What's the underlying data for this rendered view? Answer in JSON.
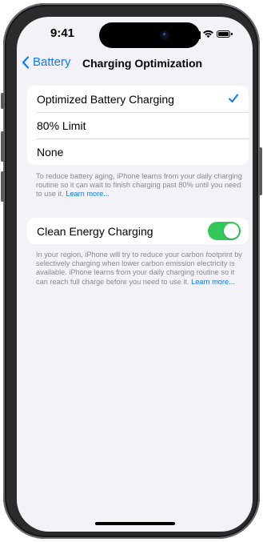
{
  "status_bar": {
    "time": "9:41",
    "icons": [
      "signal-icon",
      "wifi-icon",
      "battery-icon"
    ]
  },
  "nav": {
    "back_label": "Battery",
    "title": "Charging Optimization",
    "back_icon": "chevron-left-icon"
  },
  "charging_options": {
    "items": [
      {
        "label": "Optimized Battery Charging",
        "selected": true
      },
      {
        "label": "80% Limit",
        "selected": false
      },
      {
        "label": "None",
        "selected": false
      }
    ],
    "check_icon": "checkmark-icon",
    "footnote": "To reduce battery aging, iPhone learns from your daily charging routine so it can wait to finish charging past 80% until you need to use it.",
    "footnote_link": "Learn more..."
  },
  "clean_energy": {
    "label": "Clean Energy Charging",
    "enabled": true,
    "footnote": "In your region, iPhone will try to reduce your carbon footprint by selectively charging when lower carbon emission electricity is available. iPhone learns from your daily charging routine so it can reach full charge before you need to use it.",
    "footnote_link": "Learn more..."
  },
  "colors": {
    "accent": "#0A7AFF",
    "toggle_on": "#34C759",
    "background": "#F2F2F7",
    "secondary_text": "#8A8A8E"
  }
}
